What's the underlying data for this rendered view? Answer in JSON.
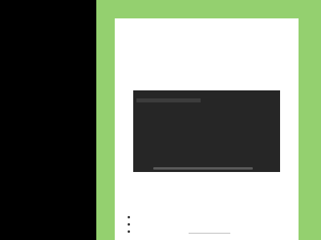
{
  "colors": {
    "left_panel": "#000000",
    "background": "#94d06f",
    "page": "#ffffff",
    "video_bg": "#262626"
  },
  "video": {
    "current_time": "",
    "total_time": "",
    "progress": 0.0
  },
  "list": {
    "items": [
      "",
      "",
      ""
    ]
  }
}
